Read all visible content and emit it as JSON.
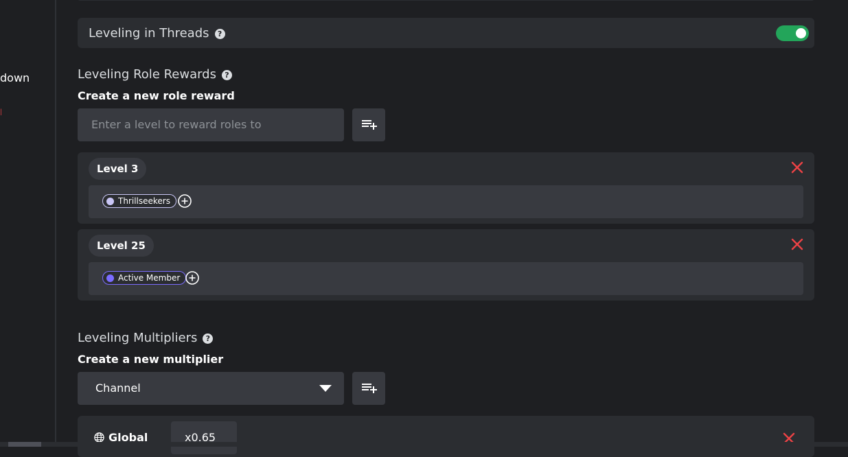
{
  "sidebar": {
    "partial_label": "down"
  },
  "threads": {
    "label": "Leveling in Threads",
    "help": "?",
    "enabled": true,
    "toggle_color": "#23a55a"
  },
  "role_rewards": {
    "title": "Leveling Role Rewards",
    "help": "?",
    "create_label": "Create a new role reward",
    "input_placeholder": "Enter a level to reward roles to",
    "rewards": [
      {
        "level": "Level 3",
        "roles": [
          {
            "name": "Thrillseekers",
            "color": "#c9c6f5"
          }
        ]
      },
      {
        "level": "Level 25",
        "roles": [
          {
            "name": "Active Member",
            "color": "#7b6cff"
          }
        ]
      }
    ]
  },
  "multipliers": {
    "title": "Leveling Multipliers",
    "help": "?",
    "create_label": "Create a new multiplier",
    "type_selected": "Channel",
    "global": {
      "label": "Global",
      "value": "x0.65"
    }
  },
  "icons": {
    "help": "question-icon",
    "add": "playlist-add-icon",
    "remove": "close-icon",
    "add_role": "plus-circle-icon",
    "globe": "globe-icon",
    "dropdown": "caret-down-icon"
  },
  "colors": {
    "danger": "#ed4245",
    "background": "#1e1f22",
    "card": "#2b2d31",
    "field": "#383a40"
  }
}
